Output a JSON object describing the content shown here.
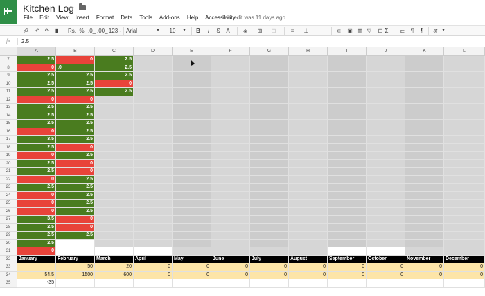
{
  "title": "Kitchen Log",
  "menu": [
    "File",
    "Edit",
    "View",
    "Insert",
    "Format",
    "Data",
    "Tools",
    "Add-ons",
    "Help",
    "Accessibility"
  ],
  "last_edit": "Last edit was 11 days ago",
  "toolbar": {
    "currency": "Rs.",
    "percent": "%",
    "dec_decrease": ".0_",
    "dec_increase": ".00_",
    "more_formats": "123 -",
    "font": "Arial",
    "font_size": "10",
    "bold": "B",
    "italic": "I",
    "strike": "S",
    "text_color": "A"
  },
  "formula_bar": {
    "fx": "fx",
    "value": "2.5"
  },
  "columns": [
    "A",
    "B",
    "C",
    "D",
    "E",
    "F",
    "G",
    "H",
    "I",
    "J",
    "K",
    "L"
  ],
  "rows": [
    {
      "num": "7",
      "cells": [
        {
          "v": "2.5",
          "c": "green"
        },
        {
          "v": "0",
          "c": "red"
        },
        {
          "v": "2.5",
          "c": "green"
        }
      ]
    },
    {
      "num": "8",
      "cells": [
        {
          "v": "0",
          "c": "red"
        },
        {
          "v": ",0",
          "c": "green",
          "t": true
        },
        {
          "v": "2.5",
          "c": "green"
        }
      ]
    },
    {
      "num": "9",
      "cells": [
        {
          "v": "2.5",
          "c": "green"
        },
        {
          "v": "2.5",
          "c": "green"
        },
        {
          "v": "2.5",
          "c": "green"
        }
      ]
    },
    {
      "num": "10",
      "cells": [
        {
          "v": "2.5",
          "c": "green"
        },
        {
          "v": "2.5",
          "c": "green"
        },
        {
          "v": "0",
          "c": "red"
        }
      ]
    },
    {
      "num": "11",
      "cells": [
        {
          "v": "2.5",
          "c": "green"
        },
        {
          "v": "2.5",
          "c": "green"
        },
        {
          "v": "2.5",
          "c": "green"
        }
      ]
    },
    {
      "num": "12",
      "cells": [
        {
          "v": "0",
          "c": "red"
        },
        {
          "v": "0",
          "c": "red"
        },
        {
          "v": "",
          "c": "gray"
        }
      ]
    },
    {
      "num": "13",
      "cells": [
        {
          "v": "2.5",
          "c": "green"
        },
        {
          "v": "2.5",
          "c": "green"
        },
        {
          "v": "",
          "c": "gray"
        }
      ]
    },
    {
      "num": "14",
      "cells": [
        {
          "v": "2.5",
          "c": "green"
        },
        {
          "v": "2.5",
          "c": "green"
        },
        {
          "v": "",
          "c": "gray"
        }
      ]
    },
    {
      "num": "15",
      "cells": [
        {
          "v": "2.5",
          "c": "green"
        },
        {
          "v": "2.5",
          "c": "green"
        },
        {
          "v": "",
          "c": "gray"
        }
      ]
    },
    {
      "num": "16",
      "cells": [
        {
          "v": "0",
          "c": "red"
        },
        {
          "v": "2.5",
          "c": "green"
        },
        {
          "v": "",
          "c": "gray"
        }
      ]
    },
    {
      "num": "17",
      "cells": [
        {
          "v": "3.5",
          "c": "green"
        },
        {
          "v": "2.5",
          "c": "green"
        },
        {
          "v": "",
          "c": "gray"
        }
      ]
    },
    {
      "num": "18",
      "cells": [
        {
          "v": "2.5",
          "c": "green"
        },
        {
          "v": "0",
          "c": "red"
        },
        {
          "v": "",
          "c": "gray"
        }
      ]
    },
    {
      "num": "19",
      "cells": [
        {
          "v": "0",
          "c": "red"
        },
        {
          "v": "2.5",
          "c": "green"
        },
        {
          "v": "",
          "c": "gray"
        }
      ]
    },
    {
      "num": "20",
      "cells": [
        {
          "v": "2.5",
          "c": "green"
        },
        {
          "v": "0",
          "c": "red"
        },
        {
          "v": "",
          "c": "gray"
        }
      ]
    },
    {
      "num": "21",
      "cells": [
        {
          "v": "2.5",
          "c": "green"
        },
        {
          "v": "0",
          "c": "red"
        },
        {
          "v": "",
          "c": "gray"
        }
      ]
    },
    {
      "num": "22",
      "cells": [
        {
          "v": "0",
          "c": "red"
        },
        {
          "v": "2.5",
          "c": "green"
        },
        {
          "v": "",
          "c": "gray"
        }
      ]
    },
    {
      "num": "23",
      "cells": [
        {
          "v": "2.5",
          "c": "green"
        },
        {
          "v": "2.5",
          "c": "green"
        },
        {
          "v": "",
          "c": "gray"
        }
      ]
    },
    {
      "num": "24",
      "cells": [
        {
          "v": "0",
          "c": "red"
        },
        {
          "v": "2.5",
          "c": "green"
        },
        {
          "v": "",
          "c": "gray"
        }
      ]
    },
    {
      "num": "25",
      "cells": [
        {
          "v": "0",
          "c": "red"
        },
        {
          "v": "2.5",
          "c": "green"
        },
        {
          "v": "",
          "c": "gray"
        }
      ]
    },
    {
      "num": "26",
      "cells": [
        {
          "v": "0",
          "c": "red"
        },
        {
          "v": "2.5",
          "c": "green"
        },
        {
          "v": "",
          "c": "gray"
        }
      ]
    },
    {
      "num": "27",
      "cells": [
        {
          "v": "3.5",
          "c": "green"
        },
        {
          "v": "0",
          "c": "red"
        },
        {
          "v": "",
          "c": "gray"
        }
      ]
    },
    {
      "num": "28",
      "cells": [
        {
          "v": "2.5",
          "c": "green"
        },
        {
          "v": "0",
          "c": "red"
        },
        {
          "v": "",
          "c": "gray"
        }
      ]
    },
    {
      "num": "29",
      "cells": [
        {
          "v": "2.5",
          "c": "green"
        },
        {
          "v": "2.5",
          "c": "green"
        },
        {
          "v": "",
          "c": "gray"
        }
      ]
    },
    {
      "num": "30",
      "cells": [
        {
          "v": "2.5",
          "c": "green"
        },
        {
          "v": "",
          "c": "white"
        },
        {
          "v": "",
          "c": "gray"
        }
      ]
    },
    {
      "num": "31",
      "cells": [
        {
          "v": "0",
          "c": "red"
        },
        {
          "v": "",
          "c": "white"
        },
        {
          "v": "",
          "c": "white"
        }
      ]
    }
  ],
  "months_row": {
    "num": "32",
    "values": [
      "January",
      "February",
      "March",
      "April",
      "May",
      "June",
      "July",
      "August",
      "September",
      "October",
      "November",
      "December"
    ]
  },
  "row33": {
    "num": "33",
    "values": [
      "",
      "50",
      "20",
      "0",
      "0",
      "0",
      "0",
      "0",
      "0",
      "0",
      "0",
      "0"
    ]
  },
  "row34": {
    "num": "34",
    "values": [
      "54.5",
      "1500",
      "600",
      "0",
      "0",
      "0",
      "0",
      "0",
      "0",
      "0",
      "0",
      "0"
    ]
  },
  "row35": {
    "num": "35",
    "values": [
      "-35",
      "",
      "",
      "",
      "",
      "",
      "",
      "",
      "",
      "",
      "",
      ""
    ]
  },
  "colors": {
    "green": "#4a7c1f",
    "red": "#e8433a",
    "gray": "#d6d6d6",
    "gray_dark": "#cccccc",
    "white": "#ffffff",
    "black": "#000000",
    "tan": "#fde5a8"
  }
}
